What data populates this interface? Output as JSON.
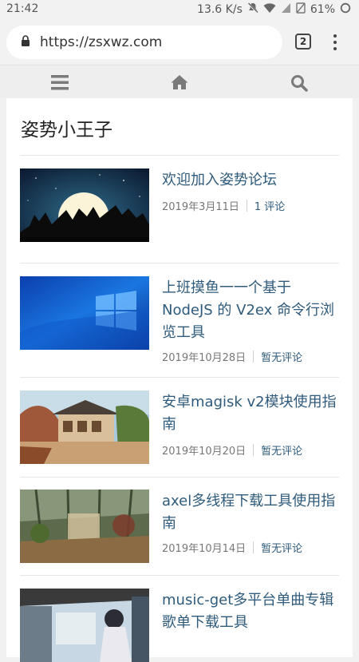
{
  "status_bar": {
    "time": "21:42",
    "speed": "13.6 K/s",
    "battery": "61%",
    "icons": [
      "mute-icon",
      "wifi-icon",
      "signal-icon",
      "no-sim-icon",
      "battery-icon"
    ]
  },
  "browser": {
    "url": "https://zsxwz.com",
    "tab_count": "2",
    "icons": [
      "lock-icon",
      "overflow-menu-icon"
    ]
  },
  "site_nav": {
    "icons": [
      "hamburger-menu-icon",
      "home-icon",
      "search-icon"
    ]
  },
  "site": {
    "title": "姿势小王子"
  },
  "posts": [
    {
      "title": "欢迎加入姿势论坛",
      "date": "2019年3月11日",
      "comments": "1 评论",
      "thumb": "anime silhouettes under full moon"
    },
    {
      "title": "上班摸鱼一一个基于 NodeJS 的 V2ex 命令行浏览工具",
      "date": "2019年10月28日",
      "comments": "暂无评论",
      "thumb": "windows 10 blue wallpaper"
    },
    {
      "title": "安卓magisk v2模块使用指南",
      "date": "2019年10月20日",
      "comments": "暂无评论",
      "thumb": "anime japanese house scenery"
    },
    {
      "title": "axel多线程下载工具使用指南",
      "date": "2019年10月14日",
      "comments": "暂无评论",
      "thumb": "anime greenhouse interior"
    },
    {
      "title": "music-get多平台单曲专辑歌单下载工具",
      "date": "",
      "comments": "",
      "thumb": "anime girl at train station"
    }
  ],
  "colors": {
    "link": "#2f5b7c",
    "meta": "#777777",
    "nav_icon": "#7a7a7a"
  }
}
